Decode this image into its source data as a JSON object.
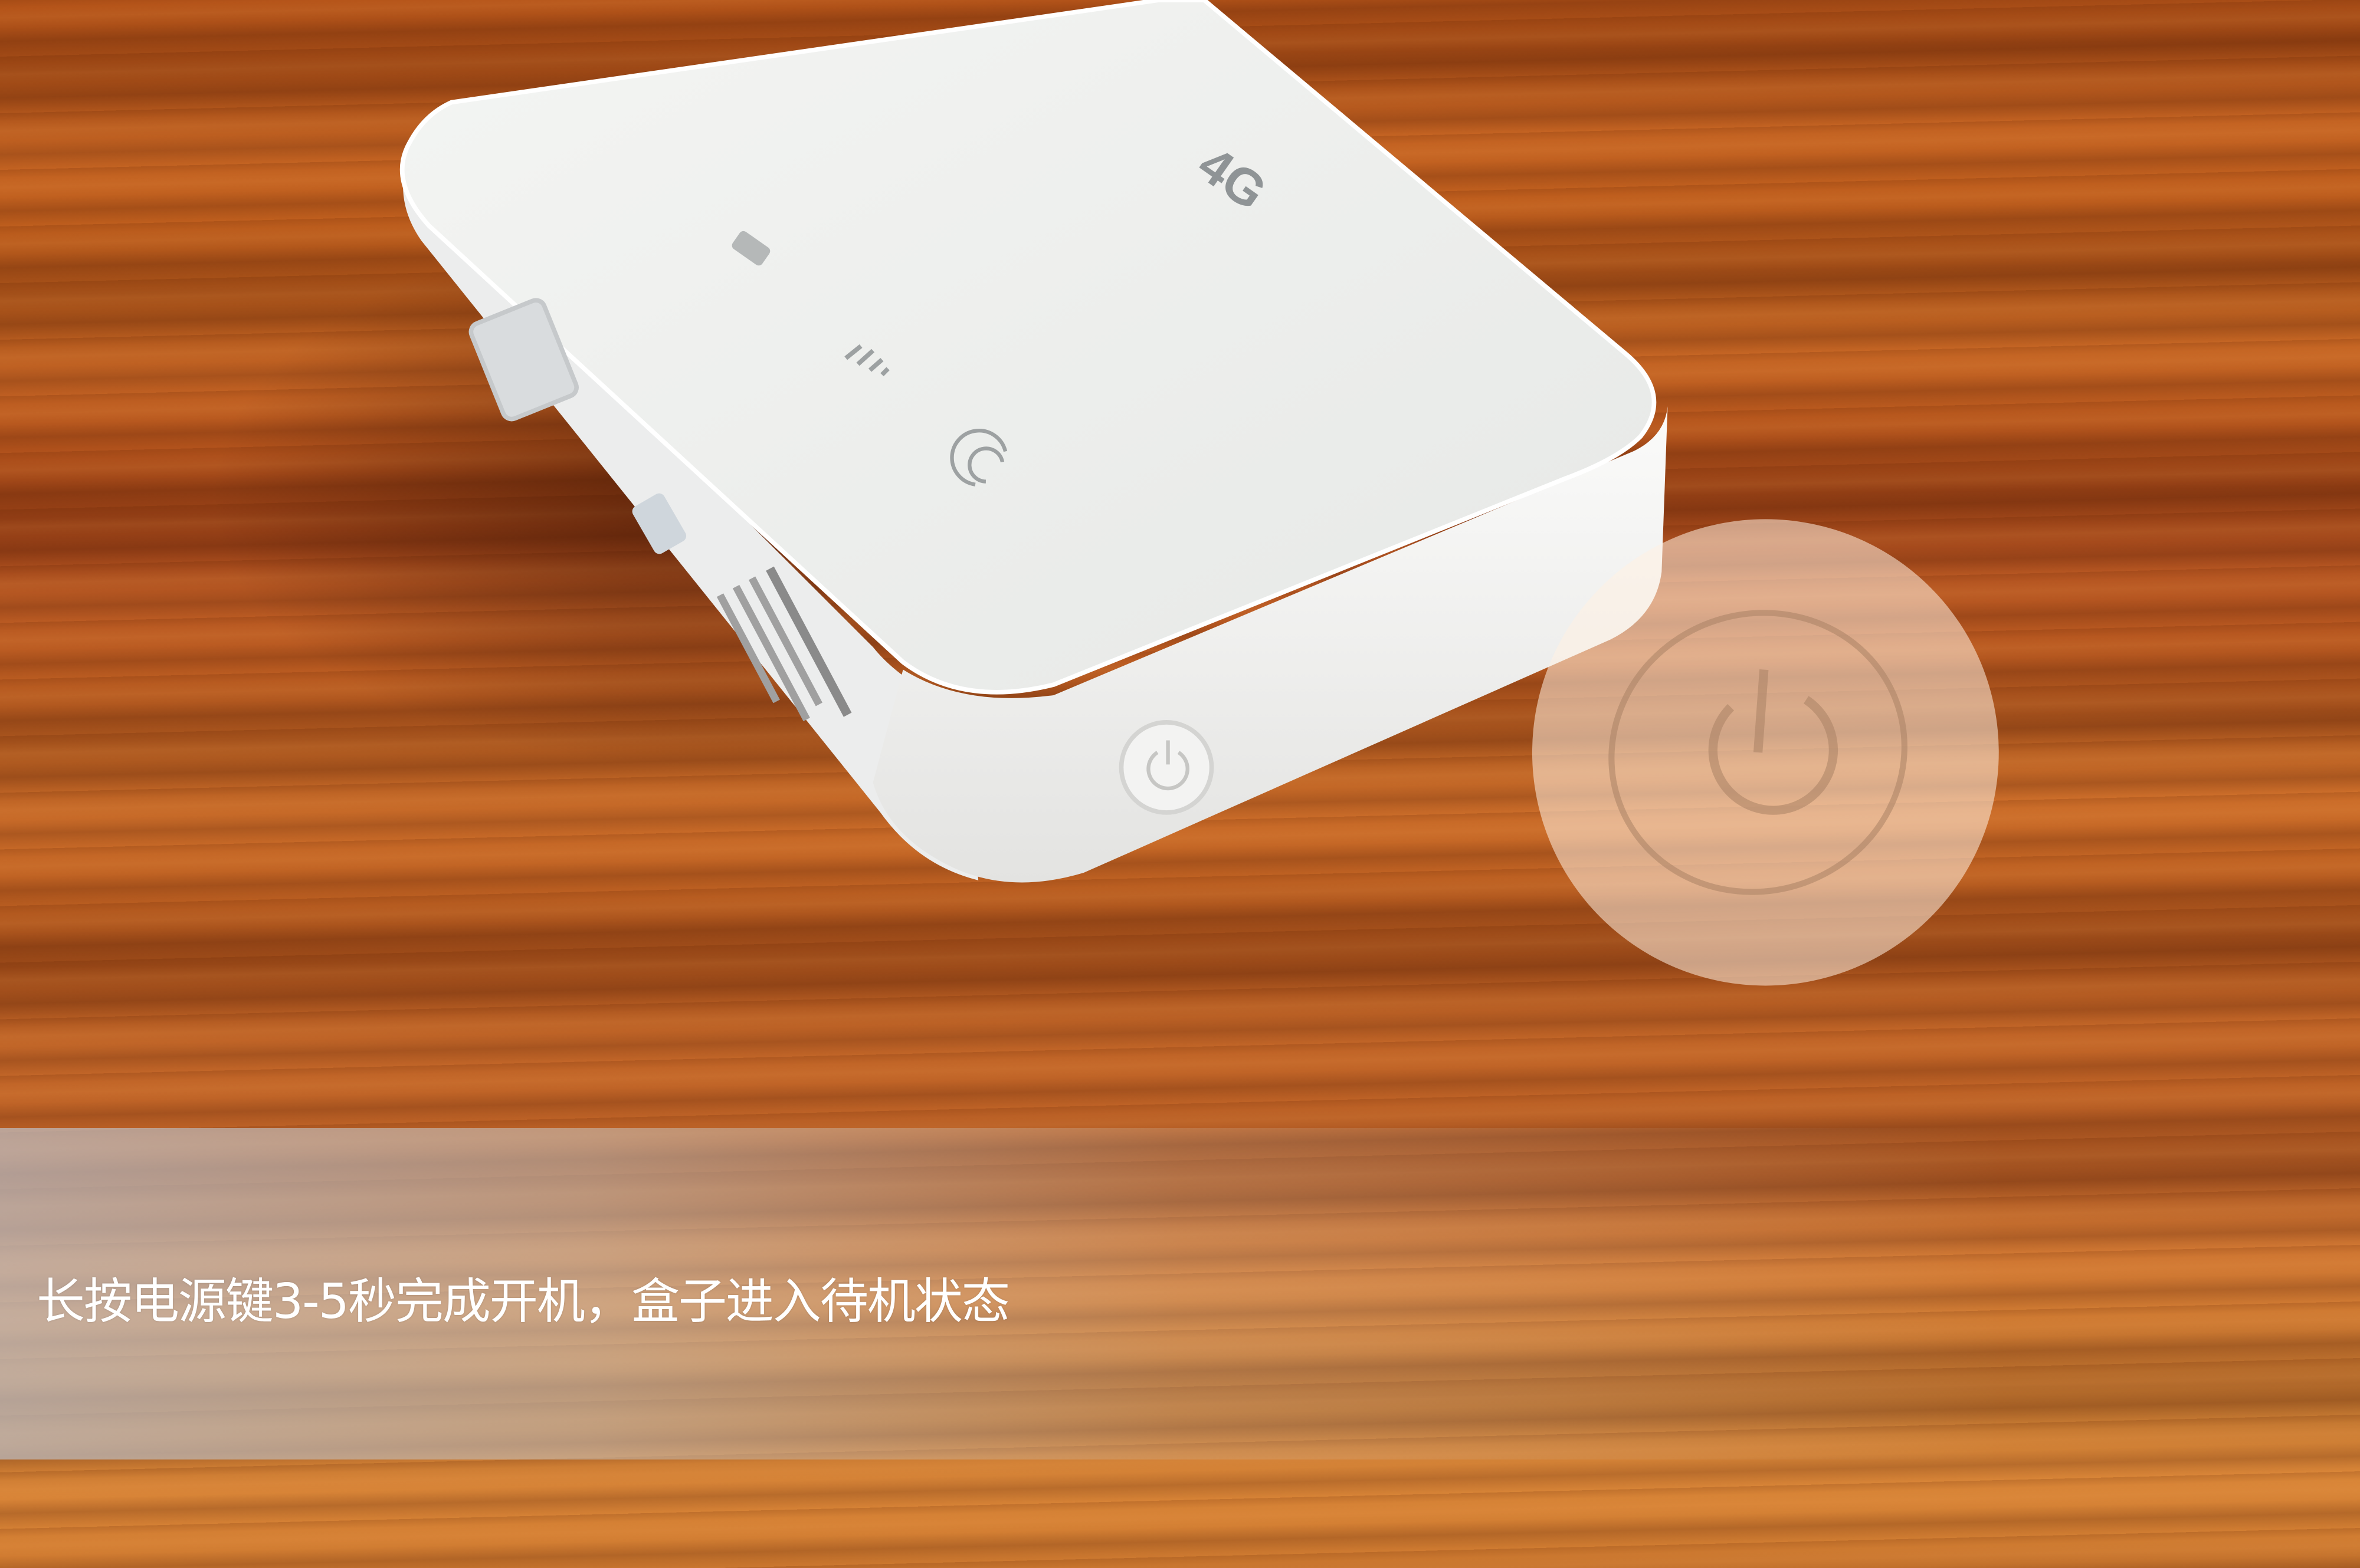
{
  "caption": "长按电源键3-5秒完成开机，盒子进入待机状态",
  "device": {
    "logo": "4G",
    "indicator_icons": [
      "battery-icon",
      "signal-icon",
      "wifi-icon"
    ],
    "power_button_icon": "power-icon"
  },
  "colors": {
    "device_body": "#f2f3f1",
    "wood": "#c2621f",
    "caption_text": "#ffffff"
  }
}
